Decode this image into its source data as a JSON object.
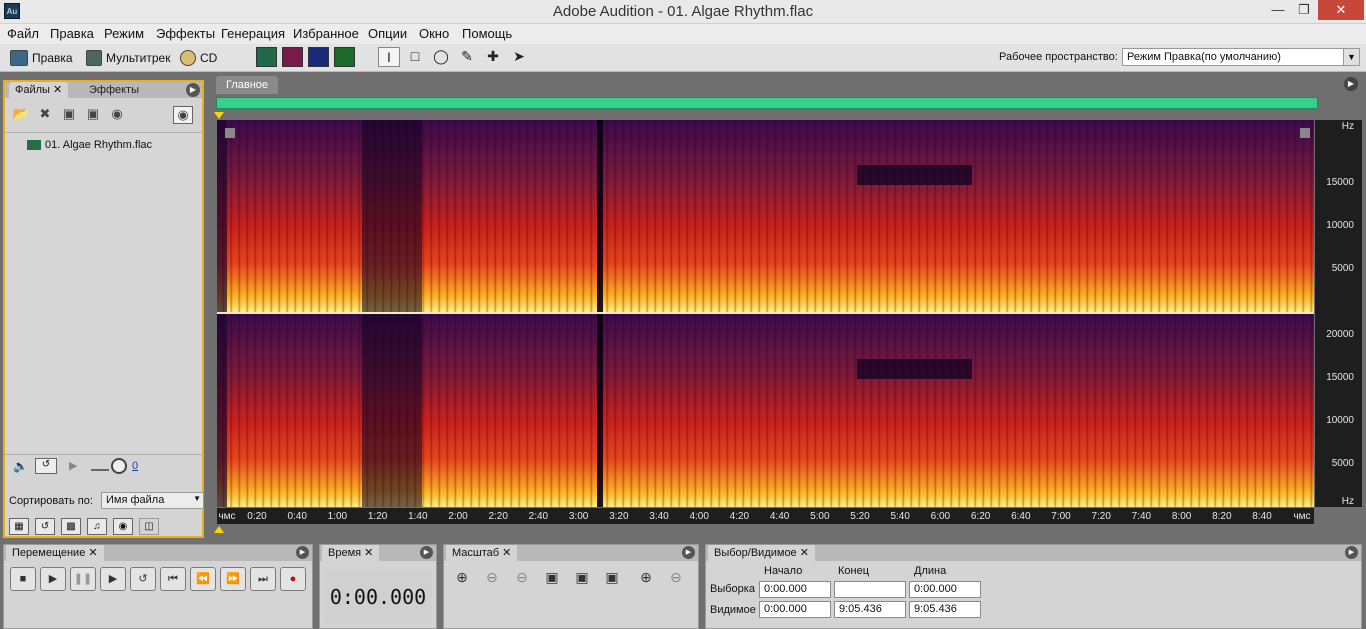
{
  "window": {
    "title": "Adobe Audition - 01. Algae Rhythm.flac",
    "app_icon": "Au"
  },
  "menu": [
    "Файл",
    "Правка",
    "Режим",
    "Эффекты",
    "Генерация",
    "Избранное",
    "Опции",
    "Окно",
    "Помощь"
  ],
  "toolbar": {
    "edit_label": "Правка",
    "multitrack_label": "Мультитрек",
    "cd_label": "CD",
    "workspace_label": "Рабочее пространство:",
    "workspace_value": "Режим Правка(по умолчанию)"
  },
  "left_panel": {
    "tab_files": "Файлы",
    "tab_effects": "Эффекты",
    "file_name": "01. Algae Rhythm.flac",
    "zoom_value": "0",
    "sort_label": "Сортировать по:",
    "sort_value": "Имя файла"
  },
  "editor": {
    "tab": "Главное",
    "hz_top": [
      "Hz",
      "15000",
      "10000",
      "5000"
    ],
    "hz_bottom": [
      "20000",
      "15000",
      "10000",
      "5000",
      "Hz"
    ],
    "time_labels": [
      "чмс",
      "0:20",
      "0:40",
      "1:00",
      "1:20",
      "1:40",
      "2:00",
      "2:20",
      "2:40",
      "3:00",
      "3:20",
      "3:40",
      "4:00",
      "4:20",
      "4:40",
      "5:00",
      "5:20",
      "5:40",
      "6:00",
      "6:20",
      "6:40",
      "7:00",
      "7:20",
      "7:40",
      "8:00",
      "8:20",
      "8:40",
      "чмс"
    ]
  },
  "transport": {
    "tab": "Перемещение"
  },
  "time": {
    "tab": "Время",
    "value": "0:00.000"
  },
  "zoom": {
    "tab": "Масштаб"
  },
  "selection": {
    "tab": "Выбор/Видимое",
    "col_start": "Начало",
    "col_end": "Конец",
    "col_length": "Длина",
    "row_selection": "Выборка",
    "row_view": "Видимое",
    "sel_start": "0:00.000",
    "sel_end": "",
    "sel_length": "0:00.000",
    "view_start": "0:00.000",
    "view_end": "9:05.436",
    "view_length": "9:05.436"
  }
}
